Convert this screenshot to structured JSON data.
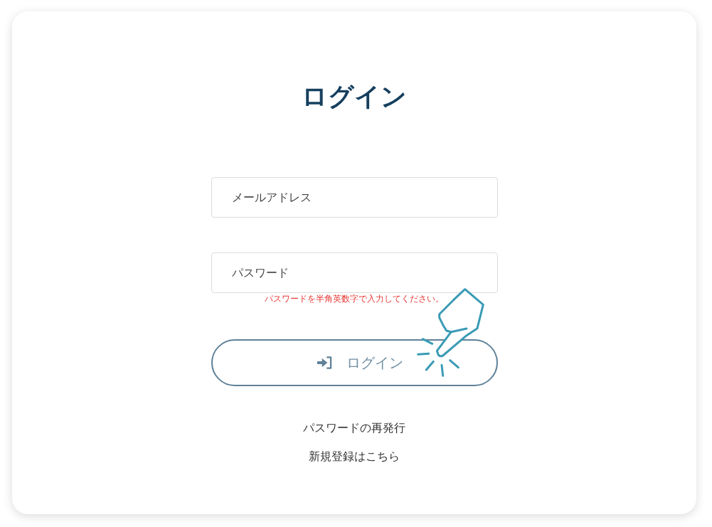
{
  "title": "ログイン",
  "form": {
    "fields": [
      {
        "placeholder": "メールアドレス"
      },
      {
        "placeholder": "パスワード"
      }
    ],
    "error_message": "パスワードを半角英数字で入力してください。",
    "submit_button": {
      "label": "ログイン"
    },
    "links": [
      "パスワードの再発行",
      "新規登録はこちら"
    ]
  }
}
